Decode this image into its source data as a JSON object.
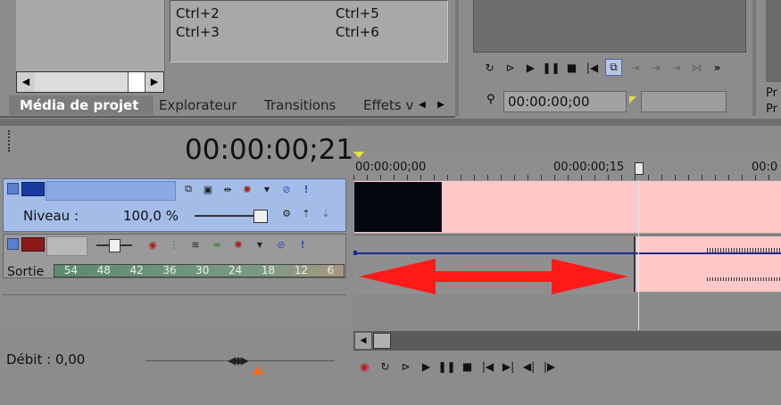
{
  "shortcuts": {
    "col1": [
      "Ctrl+2",
      "Ctrl+3"
    ],
    "col2": [
      "Ctrl+5",
      "Ctrl+6"
    ]
  },
  "tabs": [
    {
      "label": "Média de projet",
      "active": true
    },
    {
      "label": "Explorateur",
      "active": false
    },
    {
      "label": "Transitions",
      "active": false
    },
    {
      "label": "Effets v",
      "active": false
    }
  ],
  "preview": {
    "timecode": "00:00:00;00",
    "right_labels": [
      "Pr",
      "Pr"
    ]
  },
  "timeline": {
    "cursor_time": "00:00:00;21",
    "ruler": [
      "00:00:00;00",
      "00:00:00;15",
      "00:0"
    ]
  },
  "video_track": {
    "level_label": "Niveau :",
    "level_value": "100,0 %"
  },
  "audio_track": {
    "output_label": "Sortie",
    "meter_scale": [
      "54",
      "48",
      "42",
      "36",
      "30",
      "24",
      "18",
      "12",
      "6"
    ]
  },
  "rate": {
    "label": "Débit : 0,00"
  },
  "colors": {
    "event_pink": "#ffc8c8",
    "track_blue": "#a4bde8",
    "arrow_red": "#ff1a1a"
  }
}
